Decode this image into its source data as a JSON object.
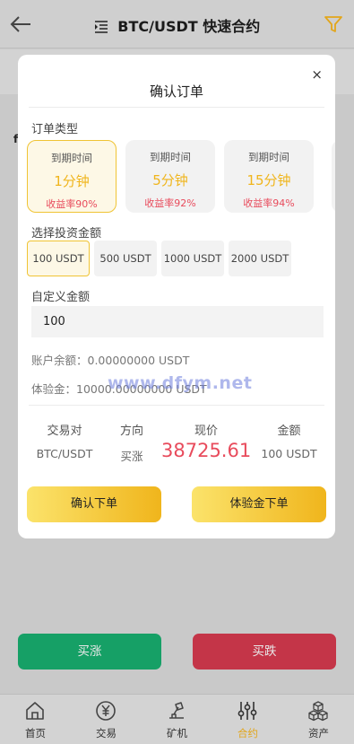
{
  "header": {
    "title": "BTC/USDT 快速合约"
  },
  "modal": {
    "title": "确认订单",
    "close": "×",
    "order_type_label": "订单类型",
    "order_cards": [
      {
        "label": "到期时间",
        "duration": "1分钟",
        "rate": "收益率90%"
      },
      {
        "label": "到期时间",
        "duration": "5分钟",
        "rate": "收益率92%"
      },
      {
        "label": "到期时间",
        "duration": "15分钟",
        "rate": "收益率94%"
      }
    ],
    "amount_label": "选择投资金额",
    "amounts": [
      "100 USDT",
      "500 USDT",
      "1000 USDT",
      "2000 USDT"
    ],
    "custom_label": "自定义金额",
    "custom_value": "100",
    "balance": "账户余额：0.00000000 USDT",
    "experience": "体验金：10000.00000000 USDT",
    "watermark": "www.dfym.net",
    "summary": {
      "pair_head": "交易对",
      "pair": "BTC/USDT",
      "dir_head": "方向",
      "dir": "买涨",
      "price_head": "现价",
      "price": "38725.61",
      "amount_head": "金额",
      "amount": "100 USDT"
    },
    "confirm_btn": "确认下单",
    "exp_btn": "体验金下单"
  },
  "actions": {
    "buy_up": "买涨",
    "buy_down": "买跌"
  },
  "tabs": [
    {
      "label": "首页",
      "icon": "home-icon"
    },
    {
      "label": "交易",
      "icon": "yen-icon"
    },
    {
      "label": "矿机",
      "icon": "miner-icon"
    },
    {
      "label": "合约",
      "icon": "sliders-icon"
    },
    {
      "label": "资产",
      "icon": "cubes-icon"
    }
  ],
  "colors": {
    "accent_gold": "#f0b51c",
    "profit_red": "#e84b5c",
    "buy_green": "#16a066",
    "sell_red": "#c43548"
  }
}
